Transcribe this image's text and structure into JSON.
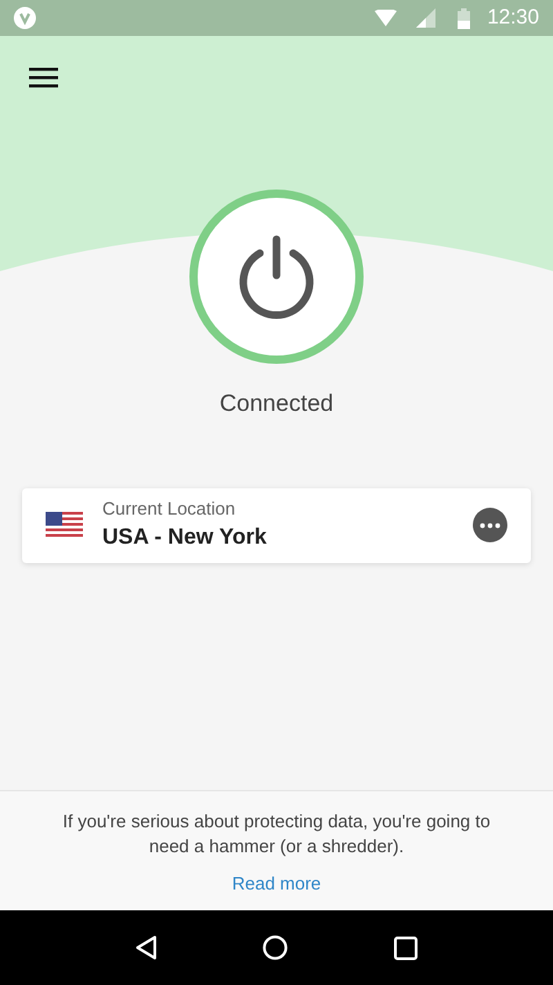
{
  "status_bar": {
    "time": "12:30"
  },
  "vpn": {
    "connected": true,
    "status": "Connected"
  },
  "location": {
    "label": "Current Location",
    "value": "USA - New York"
  },
  "footer": {
    "message": "If you're serious about protecting data, you're going to need a hammer (or a shredder).",
    "link": "Read more"
  }
}
